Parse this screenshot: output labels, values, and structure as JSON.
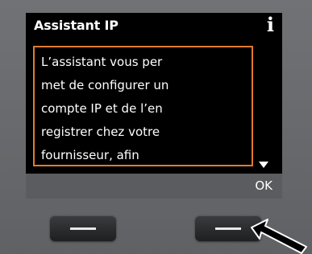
{
  "screen": {
    "title": "Assistant IP",
    "info_icon": "info-icon",
    "message_lines": [
      "L’assistant vous per",
      "met de configurer un",
      "compte IP et de l’en",
      "registrer chez votre",
      "fournisseur, afin"
    ],
    "scroll_indicator": "scroll-down-arrow-icon",
    "softkey_right_label": "OK"
  },
  "colors": {
    "screen_background": "#000000",
    "text_border": "#e07b2e",
    "softkey_bar": "#5a5c5f",
    "device_body": "#6b6d70"
  }
}
